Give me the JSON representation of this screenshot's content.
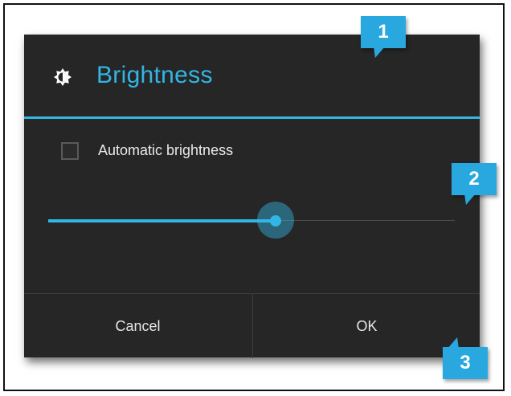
{
  "dialog": {
    "title": "Brightness",
    "title_icon": "brightness-icon",
    "automatic_brightness": {
      "label": "Automatic brightness",
      "checked": false
    },
    "brightness_slider": {
      "level": 0.56
    },
    "buttons": {
      "cancel": "Cancel",
      "ok": "OK"
    }
  },
  "callouts": [
    "1",
    "2",
    "3"
  ],
  "colors": {
    "accent": "#33b5e5",
    "dialog_background": "#262626",
    "callout": "#29a8e0"
  }
}
